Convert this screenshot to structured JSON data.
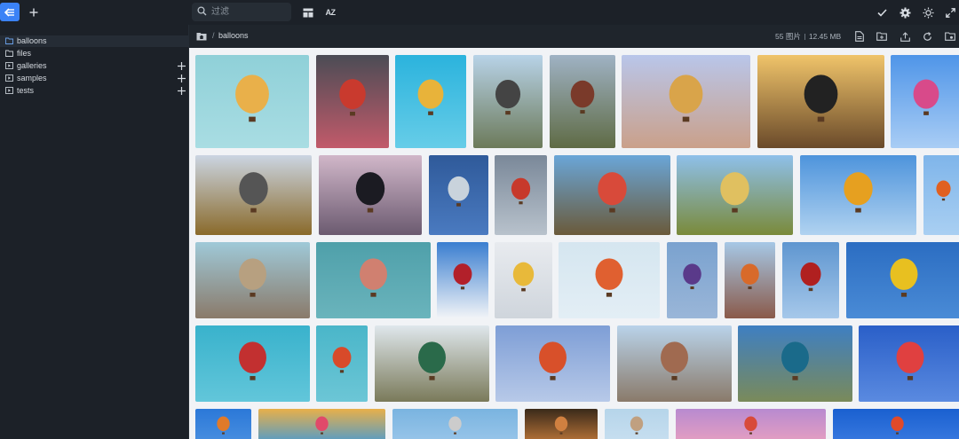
{
  "search": {
    "placeholder": "过滤"
  },
  "toolbar": {
    "sort_label": "AZ"
  },
  "sidebar": {
    "items": [
      {
        "label": "balloons",
        "active": true,
        "type": "folder"
      },
      {
        "label": "files",
        "active": false,
        "type": "folder"
      },
      {
        "label": "galleries",
        "active": false,
        "type": "gallery",
        "addable": true
      },
      {
        "label": "samples",
        "active": false,
        "type": "gallery",
        "addable": true
      },
      {
        "label": "tests",
        "active": false,
        "type": "gallery",
        "addable": true
      }
    ]
  },
  "breadcrumb": {
    "separator": "/",
    "current": "balloons"
  },
  "stats": {
    "count": "55 图片",
    "size": "12.45 MB"
  },
  "colors": {
    "accent": "#3b82f6",
    "bg": "#1c2128",
    "gallery_bg": "#f1f3f6"
  },
  "thumbnails": [
    {
      "r": 0,
      "c": [
        "#8fd0d8",
        "#a9dde3"
      ],
      "b": "#e9b04a"
    },
    {
      "r": 0,
      "c": [
        "#4b4c55",
        "#c25a6a"
      ],
      "b": "#c93a2e"
    },
    {
      "r": 0,
      "c": [
        "#2bb3dd",
        "#66cde8"
      ],
      "b": "#e8b33a"
    },
    {
      "r": 0,
      "c": [
        "#b8d3e8",
        "#6c7a5a"
      ],
      "b": "#444"
    },
    {
      "r": 0,
      "c": [
        "#9fb2c4",
        "#5f6b45"
      ],
      "b": "#7a3a2a"
    },
    {
      "r": 0,
      "c": [
        "#b9c6ea",
        "#caa08a"
      ],
      "b": "#d9a44a"
    },
    {
      "r": 0,
      "c": [
        "#f0c46a",
        "#6a4a2a"
      ],
      "b": "#222"
    },
    {
      "r": 0,
      "c": [
        "#4f95e8",
        "#a9cdf5"
      ],
      "b": "#d84a8a"
    },
    {
      "r": 1,
      "c": [
        "#cbd5e2",
        "#8a6a2a"
      ],
      "b": "#555"
    },
    {
      "r": 1,
      "c": [
        "#d1b7c9",
        "#6b5a70"
      ],
      "b": "#1b1b22"
    },
    {
      "r": 1,
      "c": [
        "#2f5a9a",
        "#4a7ac0"
      ],
      "b": "#c9d3dc"
    },
    {
      "r": 1,
      "c": [
        "#7a8899",
        "#b8c2cc"
      ],
      "b": "#c7392b"
    },
    {
      "r": 1,
      "c": [
        "#6aa6d8",
        "#6a5a3a"
      ],
      "b": "#d84a3a"
    },
    {
      "r": 1,
      "c": [
        "#8ec0ea",
        "#7a8a3a"
      ],
      "b": "#e0c060"
    },
    {
      "r": 1,
      "c": [
        "#4e94dc",
        "#b0d2f0"
      ],
      "b": "#e6a020"
    },
    {
      "r": 1,
      "c": [
        "#7fb5ea",
        "#a9cff2"
      ],
      "b": "#e06020"
    },
    {
      "r": 2,
      "c": [
        "#9fc9d8",
        "#8a7a6a"
      ],
      "b": "#b7a080"
    },
    {
      "r": 2,
      "c": [
        "#4fa0aa",
        "#6ab4bc"
      ],
      "b": "#d08070"
    },
    {
      "r": 2,
      "c": [
        "#3a7ed0",
        "#f2f4f7"
      ],
      "b": "#b2202a"
    },
    {
      "r": 2,
      "c": [
        "#e8ebef",
        "#cfd5dc"
      ],
      "b": "#e8b93a"
    },
    {
      "r": 2,
      "c": [
        "#d5e6f0",
        "#e3eef5"
      ],
      "b": "#e06030"
    },
    {
      "r": 2,
      "c": [
        "#7aa2cf",
        "#9ab6d8"
      ],
      "b": "#5a3a8a"
    },
    {
      "r": 2,
      "c": [
        "#a6c8e6",
        "#8a5a4a"
      ],
      "b": "#d86a2a"
    },
    {
      "r": 2,
      "c": [
        "#5f96d0",
        "#a6c8ea"
      ],
      "b": "#b02020"
    },
    {
      "r": 2,
      "c": [
        "#2b6dc2",
        "#4a8bd6"
      ],
      "b": "#e8c020"
    },
    {
      "r": 3,
      "c": [
        "#39b2cc",
        "#62c6da"
      ],
      "b": "#c23030"
    },
    {
      "r": 3,
      "c": [
        "#4ab6c9",
        "#6cc6d6"
      ],
      "b": "#d84a2a"
    },
    {
      "r": 3,
      "c": [
        "#dfe7ec",
        "#7a7a5a"
      ],
      "b": "#2a6a4a"
    },
    {
      "r": 3,
      "c": [
        "#7e9ed6",
        "#b7c9e8"
      ],
      "b": "#d8502a"
    },
    {
      "r": 3,
      "c": [
        "#b9d3ea",
        "#8a7a6a"
      ],
      "b": "#a06a50"
    },
    {
      "r": 3,
      "c": [
        "#3e7fc2",
        "#7a8a5a"
      ],
      "b": "#1a6a8a"
    },
    {
      "r": 3,
      "c": [
        "#2a5fc8",
        "#5a8ae0"
      ],
      "b": "#e04040"
    },
    {
      "r": 4,
      "c": [
        "#2b78d8",
        "#4a90e0"
      ],
      "b": "#e07a2a"
    },
    {
      "r": 4,
      "c": [
        "#e8b04a",
        "#4a9ad0"
      ],
      "b": "#e04a6a"
    },
    {
      "r": 4,
      "c": [
        "#7ab4e0",
        "#9ac6ea"
      ],
      "b": "#ccc"
    },
    {
      "r": 4,
      "c": [
        "#3a2a1a",
        "#c0783a"
      ],
      "b": "#d08040"
    },
    {
      "r": 4,
      "c": [
        "#b6d5ea",
        "#c8dff0"
      ],
      "b": "#c0a080"
    },
    {
      "r": 4,
      "c": [
        "#b88ad0",
        "#e8a0c0"
      ],
      "b": "#d84a3a"
    },
    {
      "r": 4,
      "c": [
        "#1a60d0",
        "#3a7ae0"
      ],
      "b": "#e04a2a"
    }
  ]
}
